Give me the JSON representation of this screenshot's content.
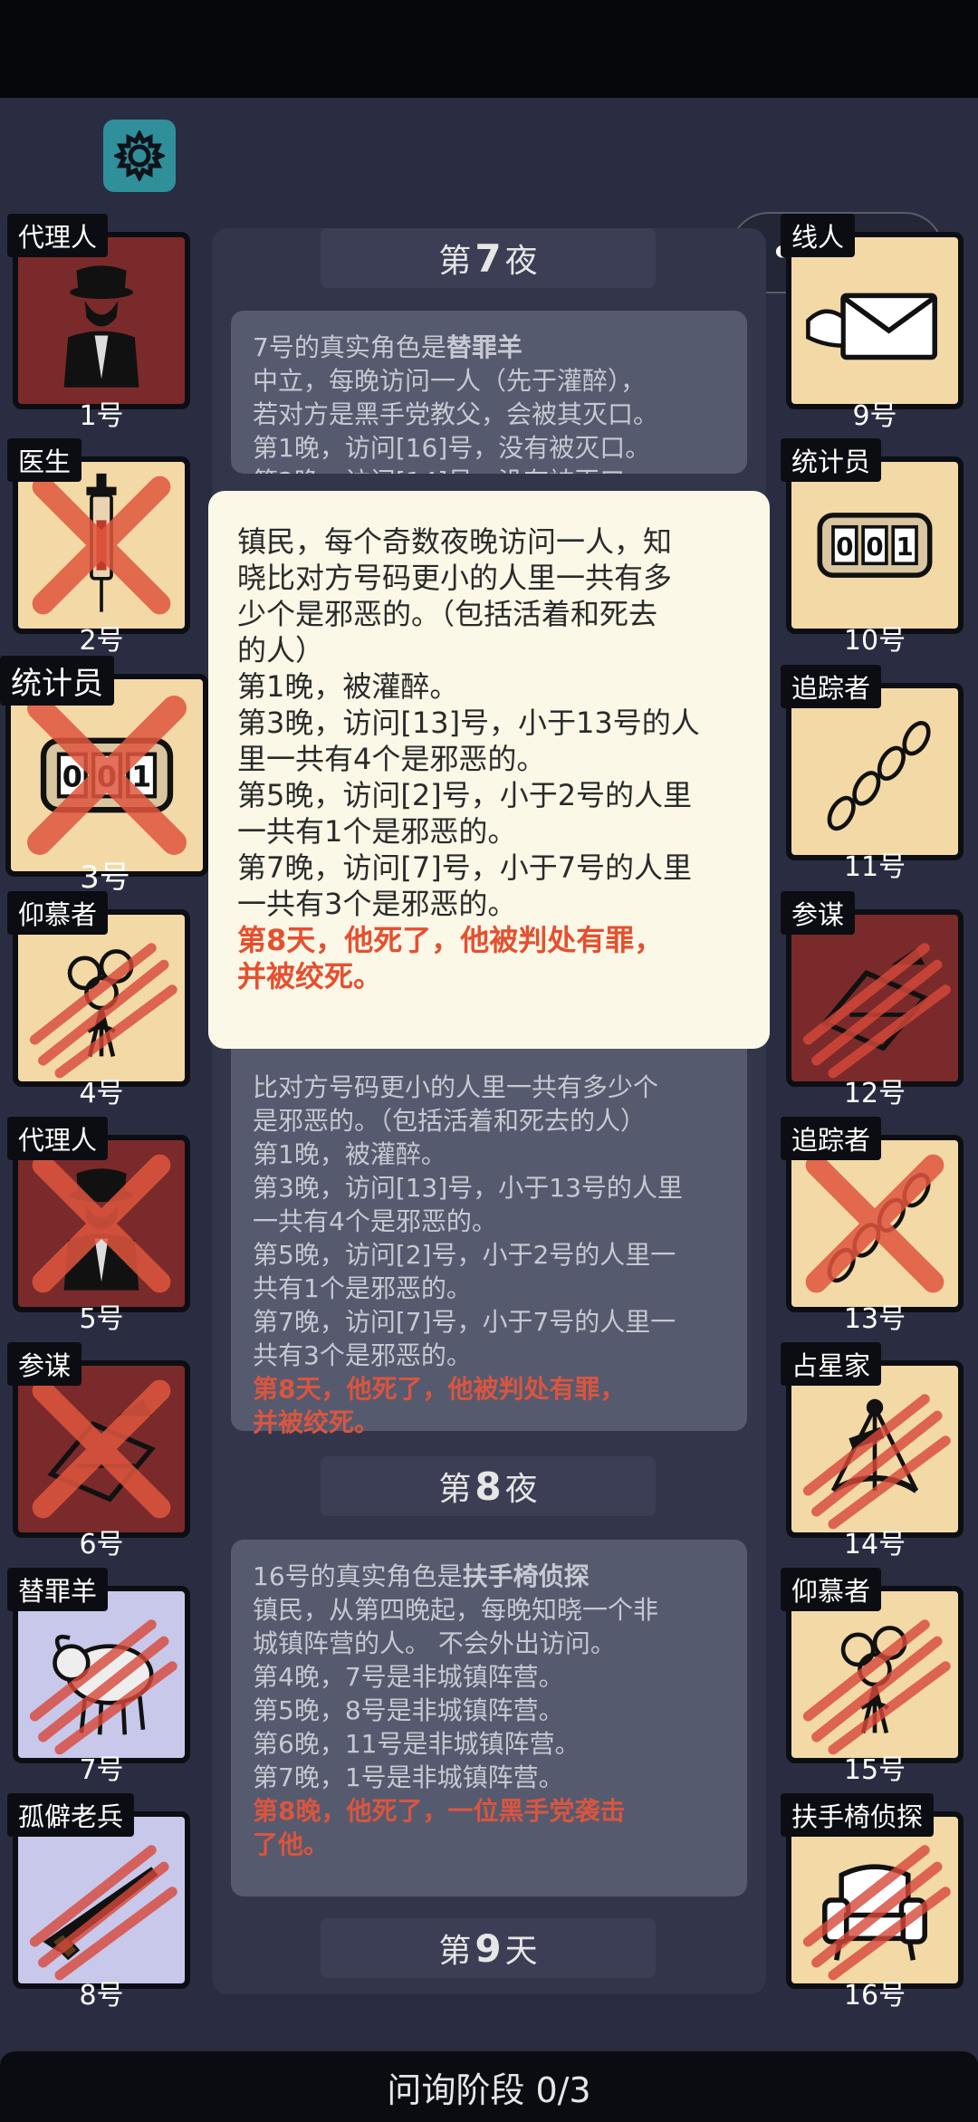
{
  "settings_icon": "gear-icon",
  "miniapp_capsule": {
    "more": "•••",
    "close": "◎"
  },
  "log": {
    "night7": {
      "prefix": "第",
      "num": "7",
      "suffix": "夜"
    },
    "entry1": {
      "title_pre": "7号的真实角色是",
      "title_role": "替罪羊",
      "lines": [
        "中立，每晚访问一人（先于灌醉），",
        "若对方是黑手党教父，会被其灭口。",
        "第1晚，访问[16]号，没有被灭口。",
        "第2晚，访问[14]号，没有被灭口。"
      ]
    },
    "entry2": {
      "lines": [
        "比对方号码更小的人里一共有多少个",
        "是邪恶的。（包括活着和死去的人）",
        "第1晚，被灌醉。",
        "第3晚，访问[13]号，小于13号的人里",
        "一共有4个是邪恶的。",
        "第5晚，访问[2]号，小于2号的人里一",
        "共有1个是邪恶的。",
        "第7晚，访问[7]号，小于7号的人里一",
        "共有3个是邪恶的。"
      ],
      "red": [
        "第8天，他死了，他被判处有罪，",
        "并被绞死。"
      ]
    },
    "night8": {
      "prefix": "第",
      "num": "8",
      "suffix": "夜"
    },
    "entry3": {
      "title_pre": "16号的真实角色是",
      "title_role": "扶手椅侦探",
      "lines": [
        "镇民，从第四晚起，每晚知晓一个非",
        "城镇阵营的人。 不会外出访问。",
        "第4晚，7号是非城镇阵营。",
        "第5晚，8号是非城镇阵营。",
        "第6晚，11号是非城镇阵营。",
        "第7晚，1号是非城镇阵营。"
      ],
      "red": [
        "第8晚，他死了，一位黑手党袭击",
        "了他。"
      ]
    },
    "day9": {
      "prefix": "第",
      "num": "9",
      "suffix": "天"
    }
  },
  "popup": {
    "lines": [
      "镇民，每个奇数夜晚访问一人，知",
      "晓比对方号码更小的人里一共有多",
      "少个是邪恶的。（包括活着和死去",
      "的人）",
      "第1晚，被灌醉。",
      "第3晚，访问[13]号，小于13号的人",
      "里一共有4个是邪恶的。",
      "第5晚，访问[2]号，小于2号的人里",
      "一共有1个是邪恶的。",
      "第7晚，访问[7]号，小于7号的人里",
      "一共有3个是邪恶的。"
    ],
    "red": [
      "第8天，他死了，他被判处有罪，",
      "并被绞死。"
    ]
  },
  "players_left": [
    {
      "role": "代理人",
      "num": "1号",
      "bg": "#7a2a2a",
      "icon": "suit-icon",
      "state": "alive"
    },
    {
      "role": "医生",
      "num": "2号",
      "bg": "#f2d9a6",
      "icon": "syringe-icon",
      "state": "executed"
    },
    {
      "role": "统计员",
      "num": "3号",
      "bg": "#f2d9a6",
      "icon": "counter-icon",
      "state": "executed"
    },
    {
      "role": "仰慕者",
      "num": "4号",
      "bg": "#f2d9a6",
      "icon": "flowers-icon",
      "state": "killed"
    },
    {
      "role": "代理人",
      "num": "5号",
      "bg": "#7a2a2a",
      "icon": "suit-icon",
      "state": "executed"
    },
    {
      "role": "参谋",
      "num": "6号",
      "bg": "#7a2a2a",
      "icon": "document-icon",
      "state": "executed"
    },
    {
      "role": "替罪羊",
      "num": "7号",
      "bg": "#c7c8ea",
      "icon": "goat-icon",
      "state": "killed"
    },
    {
      "role": "孤僻老兵",
      "num": "8号",
      "bg": "#c7c8ea",
      "icon": "rifle-icon",
      "state": "killed"
    }
  ],
  "players_right": [
    {
      "role": "线人",
      "num": "9号",
      "bg": "#f2d9a6",
      "icon": "envelope-icon",
      "state": "alive"
    },
    {
      "role": "统计员",
      "num": "10号",
      "bg": "#f2d9a6",
      "icon": "counter-icon",
      "state": "alive"
    },
    {
      "role": "追踪者",
      "num": "11号",
      "bg": "#f2d9a6",
      "icon": "footprints-icon",
      "state": "alive"
    },
    {
      "role": "参谋",
      "num": "12号",
      "bg": "#7a2a2a",
      "icon": "document-icon",
      "state": "killed"
    },
    {
      "role": "追踪者",
      "num": "13号",
      "bg": "#f2d9a6",
      "icon": "footprints-icon",
      "state": "executed"
    },
    {
      "role": "占星家",
      "num": "14号",
      "bg": "#f2d9a6",
      "icon": "sextant-icon",
      "state": "killed"
    },
    {
      "role": "仰慕者",
      "num": "15号",
      "bg": "#f2d9a6",
      "icon": "flowers-icon",
      "state": "killed"
    },
    {
      "role": "扶手椅侦探",
      "num": "16号",
      "bg": "#f2d9a6",
      "icon": "armchair-icon",
      "state": "killed"
    }
  ],
  "bottom_bar": {
    "label": "问询阶段 0/3"
  }
}
